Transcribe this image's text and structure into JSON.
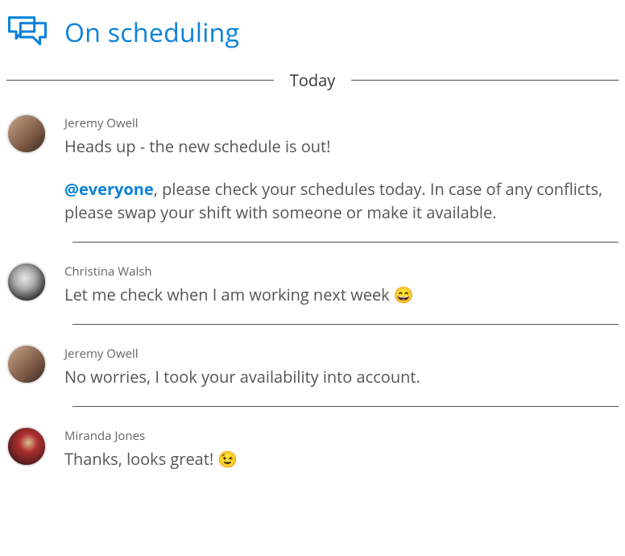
{
  "header": {
    "title": "On scheduling"
  },
  "divider": {
    "label": "Today"
  },
  "messages": [
    {
      "author": "Jeremy Owell",
      "avatar": "jeremy",
      "lines": [
        {
          "plain": "Heads up - the new schedule is out!"
        },
        {
          "mention": "@everyone",
          "rest": ", please check your schedules today. In case of any conflicts, please swap your shift with someone or make it available."
        }
      ]
    },
    {
      "author": "Christina Walsh",
      "avatar": "christina",
      "lines": [
        {
          "plain": "Let me check when I am working next week ",
          "emoji": "😄"
        }
      ]
    },
    {
      "author": "Jeremy Owell",
      "avatar": "jeremy",
      "lines": [
        {
          "plain": "No worries, I took your availability into account."
        }
      ]
    },
    {
      "author": "Miranda Jones",
      "avatar": "miranda",
      "lines": [
        {
          "plain": "Thanks, looks great! ",
          "emoji": "😉"
        }
      ]
    }
  ]
}
